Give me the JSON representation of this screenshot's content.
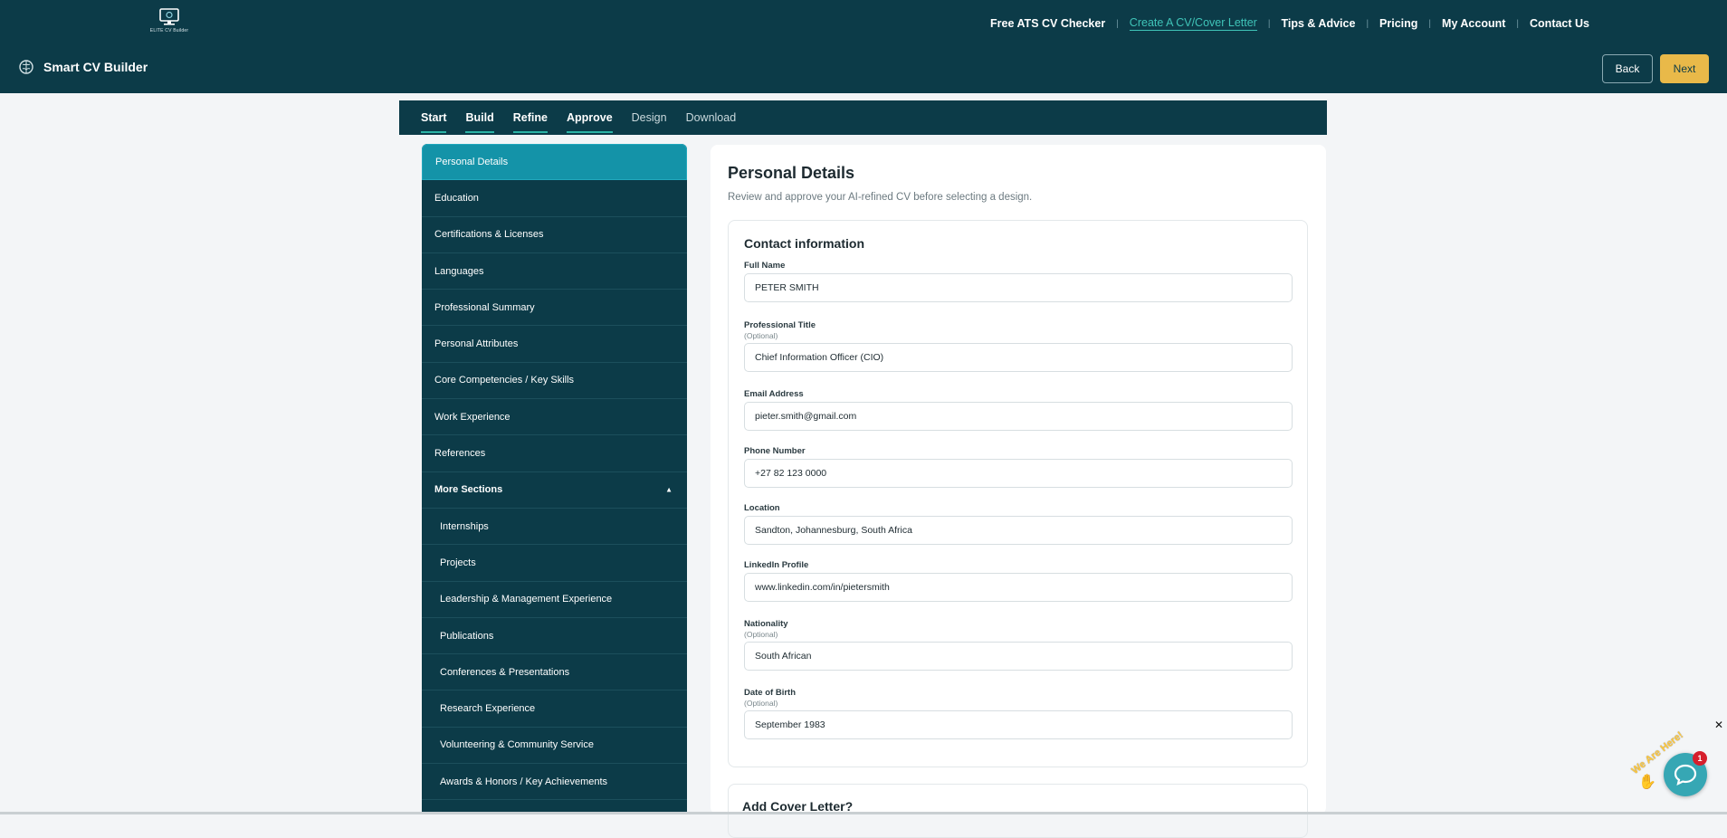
{
  "logo": {
    "text": "ELITE CV Builder"
  },
  "topnav": {
    "links": [
      {
        "label": "Free ATS CV Checker",
        "active": false
      },
      {
        "label": "Create A CV/Cover Letter",
        "active": true
      },
      {
        "label": "Tips & Advice",
        "active": false
      },
      {
        "label": "Pricing",
        "active": false
      },
      {
        "label": "My Account",
        "active": false
      },
      {
        "label": "Contact Us",
        "active": false
      }
    ]
  },
  "brand": {
    "title": "Smart CV Builder",
    "icon": "brain-icon"
  },
  "actions": {
    "back_label": "Back",
    "next_label": "Next"
  },
  "steps": [
    {
      "label": "Start",
      "status": "done"
    },
    {
      "label": "Build",
      "status": "done"
    },
    {
      "label": "Refine",
      "status": "done"
    },
    {
      "label": "Approve",
      "status": "done"
    },
    {
      "label": "Design",
      "status": "pending"
    },
    {
      "label": "Download",
      "status": "pending"
    }
  ],
  "sidebar": {
    "items": [
      "Personal Details",
      "Education",
      "Certifications & Licenses",
      "Languages",
      "Professional Summary",
      "Personal Attributes",
      "Core Competencies / Key Skills",
      "Work Experience",
      "References"
    ],
    "active_item": "Personal Details",
    "more_sections_label": "More Sections",
    "more_items": [
      "Internships",
      "Projects",
      "Leadership & Management Experience",
      "Publications",
      "Conferences & Presentations",
      "Research Experience",
      "Volunteering & Community Service",
      "Awards & Honors / Key Achievements"
    ]
  },
  "main": {
    "title": "Personal Details",
    "subtitle": "Review and approve your AI-refined CV before selecting a design.",
    "contact_heading": "Contact information",
    "fields": [
      {
        "label": "Full Name",
        "optional": "",
        "value": "PETER SMITH"
      },
      {
        "label": "Professional Title",
        "optional": "(Optional)",
        "value": "Chief Information Officer (CIO)"
      },
      {
        "label": "Email Address",
        "optional": "",
        "value": "pieter.smith@gmail.com"
      },
      {
        "label": "Phone Number",
        "optional": "",
        "value": "+27 82 123 0000"
      },
      {
        "label": "Location",
        "optional": "",
        "value": "Sandton, Johannesburg, South Africa"
      },
      {
        "label": "LinkedIn Profile",
        "optional": "",
        "value": "www.linkedin.com/in/pietersmith"
      },
      {
        "label": "Nationality",
        "optional": "(Optional)",
        "value": "South African"
      },
      {
        "label": "Date of Birth",
        "optional": "(Optional)",
        "value": "September 1983"
      }
    ],
    "cover_heading": "Add Cover Letter?"
  },
  "chat": {
    "bubble_text": "We Are Here!",
    "badge_count": "1",
    "close_label": "✕"
  },
  "colors": {
    "header_bg": "#0c3b48",
    "active_sidebar": "#1493a8",
    "accent_teal": "#2bb3a5",
    "next_button": "#e9b949",
    "chat_button": "#36a7b4"
  }
}
